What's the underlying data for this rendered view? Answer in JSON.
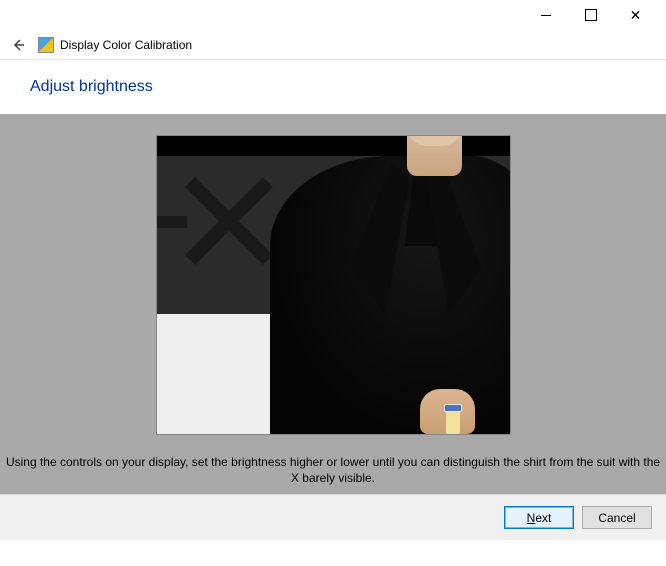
{
  "window": {
    "app_title": "Display Color Calibration"
  },
  "page": {
    "heading": "Adjust brightness",
    "instruction": "Using the controls on your display, set the brightness higher or lower until you can distinguish the shirt from the suit with the X barely visible."
  },
  "buttons": {
    "next": "Next",
    "cancel": "Cancel"
  }
}
